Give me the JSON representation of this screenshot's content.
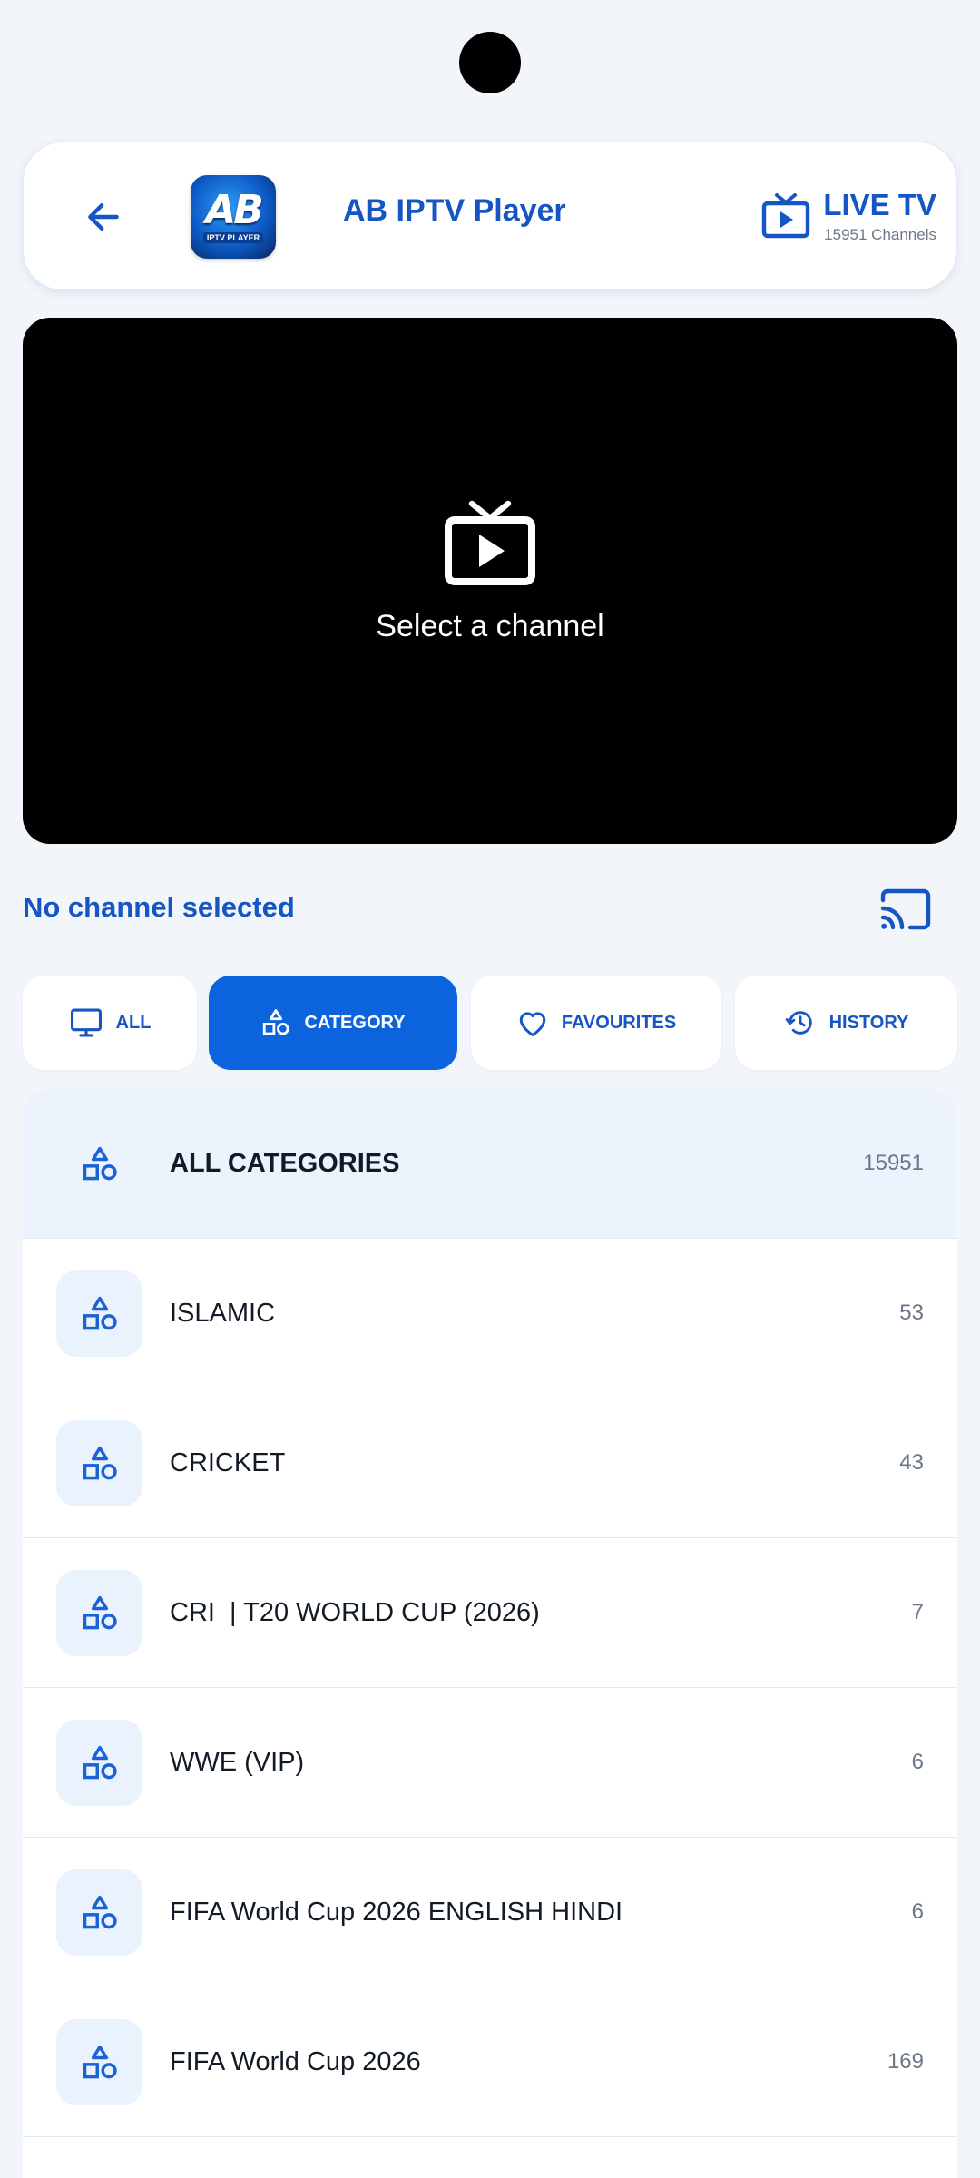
{
  "header": {
    "app_title": "AB IPTV Player",
    "logo_text": "AB",
    "logo_sub": "IPTV PLAYER",
    "section_title": "LIVE TV",
    "channel_count_text": "15951 Channels"
  },
  "player": {
    "placeholder": "Select a channel"
  },
  "now_playing": {
    "title": "No channel selected"
  },
  "tabs": [
    {
      "label": "ALL",
      "icon": "monitor-icon",
      "active": false
    },
    {
      "label": "CATEGORY",
      "icon": "category-shapes-icon",
      "active": true
    },
    {
      "label": "FAVOURITES",
      "icon": "heart-icon",
      "active": false
    },
    {
      "label": "HISTORY",
      "icon": "history-icon",
      "active": false
    }
  ],
  "categories": [
    {
      "name": "ALL CATEGORIES",
      "count": "15951"
    },
    {
      "name": "ISLAMIC",
      "count": "53"
    },
    {
      "name": "CRICKET",
      "count": "43"
    },
    {
      "name": "CRI  | T20 WORLD CUP (2026)",
      "count": "7"
    },
    {
      "name": "WWE (VIP)",
      "count": "6"
    },
    {
      "name": "FIFA World Cup 2026 ENGLISH HINDI",
      "count": "6"
    },
    {
      "name": "FIFA World Cup 2026",
      "count": "169"
    }
  ],
  "colors": {
    "accent": "#0b63de",
    "title_blue": "#1556c4",
    "background": "#f2f6fb",
    "player_bg": "#000000"
  }
}
